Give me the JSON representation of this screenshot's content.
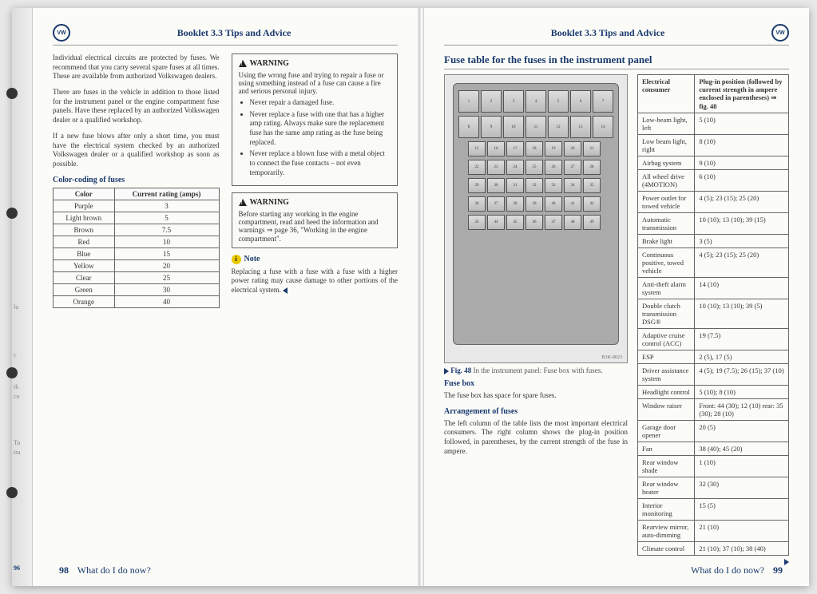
{
  "booklet": "Booklet 3.3  Tips and Advice",
  "logo_text": "VW",
  "footer_title": "What do I do now?",
  "page_left_outer": "96",
  "page_left_inner": "98",
  "page_right": "99",
  "left_page": {
    "para1": "Individual electrical circuits are protected by fuses. We recommend that you carry several spare fuses at all times. These are available from authorized Volkswagen dealers.",
    "para2": "There are fuses in the vehicle in addition to those listed for the instrument panel or the engine compartment fuse panels. Have these replaced by an authorized Volkswagen dealer or a qualified workshop.",
    "para3": "If a new fuse blows after only a short time, you must have the electrical system checked by an authorized Volkswagen dealer or a qualified workshop as soon as possible.",
    "color_heading": "Color-coding of fuses",
    "color_table": {
      "h1": "Color",
      "h2": "Current rating (amps)",
      "rows": [
        {
          "c": "Purple",
          "a": "3"
        },
        {
          "c": "Light brown",
          "a": "5"
        },
        {
          "c": "Brown",
          "a": "7.5"
        },
        {
          "c": "Red",
          "a": "10"
        },
        {
          "c": "Blue",
          "a": "15"
        },
        {
          "c": "Yellow",
          "a": "20"
        },
        {
          "c": "Clear",
          "a": "25"
        },
        {
          "c": "Green",
          "a": "30"
        },
        {
          "c": "Orange",
          "a": "40"
        }
      ]
    },
    "warn1": {
      "title": "WARNING",
      "body": "Using the wrong fuse and trying to repair a fuse or using something instead of a fuse can cause a fire and serious personal injury.",
      "bullets": [
        "Never repair a damaged fuse.",
        "Never replace a fuse with one that has a higher amp rating. Always make sure the replacement fuse has the same amp rating as the fuse being replaced.",
        "Never replace a blown fuse with a metal object to connect the fuse contacts – not even temporarily."
      ]
    },
    "warn2": {
      "title": "WARNING",
      "body": "Before starting any working in the engine compartment, read and heed the information and warnings ⇒ page 36, \"Working in the engine compartment\"."
    },
    "note_title": "Note",
    "note_body": "Replacing a fuse with a fuse with a fuse with a higher power rating may cause damage to other portions of the electrical system."
  },
  "right_page": {
    "title": "Fuse table for the fuses in the instrument panel",
    "diagram_ref": "B1K-0023",
    "caption_label": "Fig. 48",
    "caption_text": "In the instrument panel: Fuse box with fuses.",
    "sub1": "Fuse box",
    "sub1_text": "The fuse box has space for spare fuses.",
    "sub2": "Arrangement of fuses",
    "sub2_text": "The left column of the table lists the most important electrical consumers. The right column shows the plug-in position followed, in parentheses, by the current strength of the fuse in ampere.",
    "table_h1": "Electrical consumer",
    "table_h2": "Plug-in position (followed by current strength in ampere enclosed in parentheses) ⇒ fig. 48",
    "fuse_rows": [
      {
        "c": "Low-beam light, left",
        "p": "5 (10)"
      },
      {
        "c": "Low beam light, right",
        "p": "8 (10)"
      },
      {
        "c": "Airbag system",
        "p": "9 (10)"
      },
      {
        "c": "All wheel drive (4MOTION)",
        "p": "6 (10)"
      },
      {
        "c": "Power outlet for towed vehicle",
        "p": "4 (5); 23 (15); 25 (20)"
      },
      {
        "c": "Automatic transmission",
        "p": "10 (10); 13 (10); 39 (15)"
      },
      {
        "c": "Brake light",
        "p": "3 (5)"
      },
      {
        "c": "Continuous positive, towed vehicle",
        "p": "4 (5); 23 (15); 25 (20)"
      },
      {
        "c": "Anti-theft alarm system",
        "p": "14 (10)"
      },
      {
        "c": "Double clutch transmission DSG®",
        "p": "10 (10); 13 (10); 39 (5)"
      },
      {
        "c": "Adaptive cruise control (ACC)",
        "p": "19 (7.5)"
      },
      {
        "c": "ESP",
        "p": "2 (5), 17 (5)"
      },
      {
        "c": "Driver assistance system",
        "p": "4 (5); 19 (7.5); 26 (15); 37 (10)"
      },
      {
        "c": "Headlight control",
        "p": "5 (10); 8 (10)"
      },
      {
        "c": "Window raiser",
        "p": "Front: 44 (30); 12 (10) rear: 35 (30); 28 (10)"
      },
      {
        "c": "Garage door opener",
        "p": "20 (5)"
      },
      {
        "c": "Fan",
        "p": "38 (40); 45 (20)"
      },
      {
        "c": "Rear window shade",
        "p": "1 (10)"
      },
      {
        "c": "Rear window heater",
        "p": "32 (30)"
      },
      {
        "c": "Interior monitoring",
        "p": "15 (5)"
      },
      {
        "c": "Rearview mirror, auto-dimming",
        "p": "21 (10)"
      },
      {
        "c": "Climate control",
        "p": "21 (10); 37 (10); 38 (40)"
      }
    ]
  },
  "diagram_rows": [
    [
      1,
      2,
      3,
      4,
      5,
      6,
      7
    ],
    [
      8,
      9,
      10,
      11,
      12,
      13,
      14
    ],
    [
      15,
      16,
      17,
      18,
      19,
      20,
      21
    ],
    [
      22,
      23,
      24,
      25,
      26,
      27,
      28
    ],
    [
      29,
      30,
      31,
      32,
      33,
      34,
      35
    ],
    [
      36,
      37,
      38,
      39,
      40,
      41,
      42
    ],
    [
      43,
      44,
      45,
      46,
      47,
      48,
      49
    ]
  ]
}
